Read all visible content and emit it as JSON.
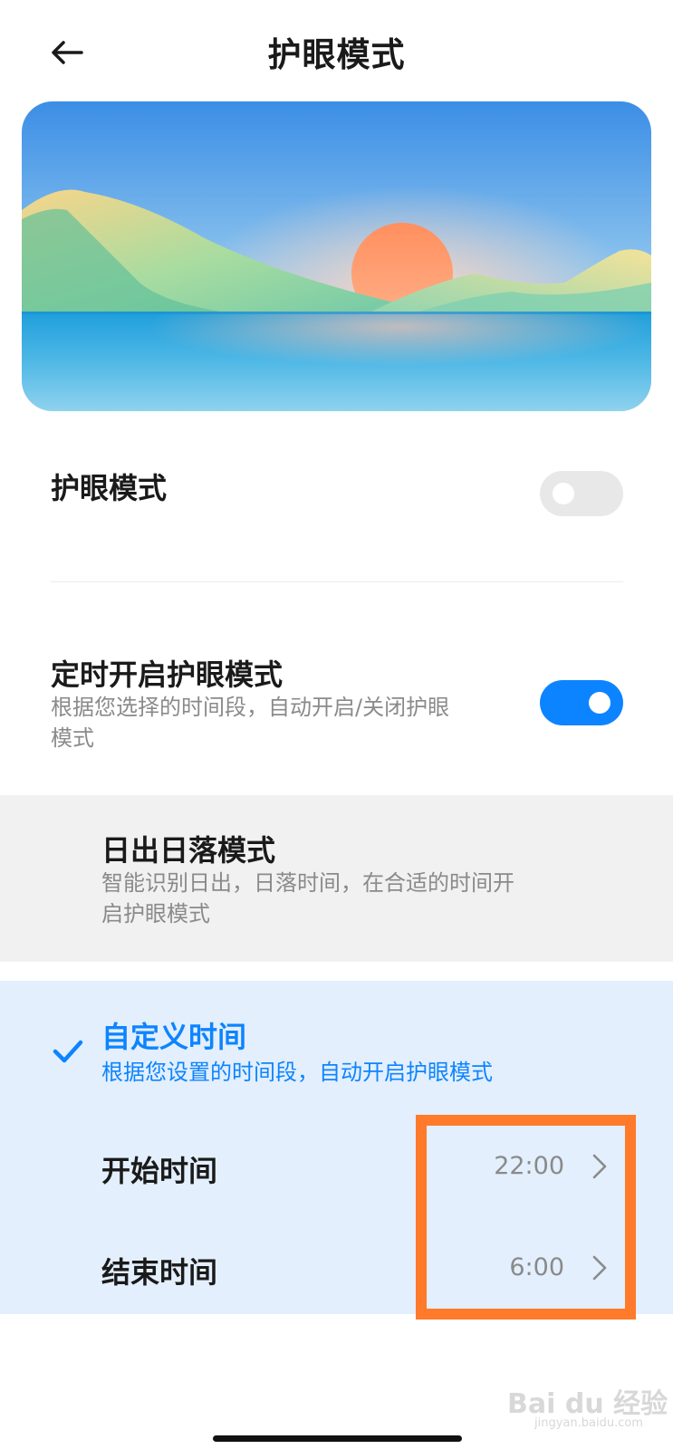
{
  "header": {
    "title": "护眼模式"
  },
  "eye_mode": {
    "label": "护眼模式",
    "enabled": false
  },
  "schedule": {
    "label": "定时开启护眼模式",
    "description_line1": "根据您选择的时间段，自动开启/关闭护眼",
    "description_line2": "模式",
    "enabled": true
  },
  "sunrise_option": {
    "label": "日出日落模式",
    "description_line1": "智能识别日出，日落时间，在合适的时间开",
    "description_line2": "启护眼模式",
    "selected": false
  },
  "custom_option": {
    "label": "自定义时间",
    "description": "根据您设置的时间段，自动开启护眼模式",
    "selected": true,
    "start": {
      "label": "开始时间",
      "value": "22:00"
    },
    "end": {
      "label": "结束时间",
      "value": "6:00"
    }
  },
  "watermark": {
    "text": "Bai du 经验",
    "sub": "jingyan.baidu.com"
  },
  "colors": {
    "accent": "#0d84ff",
    "highlight": "#ff7a2a",
    "selected_bg": "#e3effc",
    "option_bg": "#f1f1f1"
  }
}
